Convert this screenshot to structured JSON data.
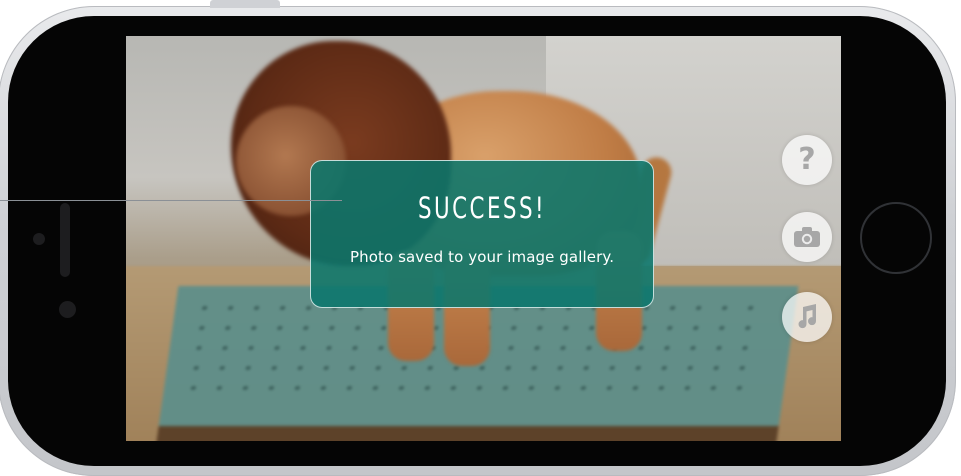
{
  "toast": {
    "title": "SUCCESS!",
    "message": "Photo saved to your image gallery."
  },
  "controls": [
    {
      "name": "help",
      "icon": "question-mark-icon",
      "glyph": "?"
    },
    {
      "name": "camera",
      "icon": "camera-icon"
    },
    {
      "name": "music",
      "icon": "music-note-icon"
    }
  ],
  "colors": {
    "toast_background": "#0a766c",
    "toast_text": "#ffffff",
    "control_background": "#ffffff",
    "control_icon": "#a7a7a7"
  }
}
